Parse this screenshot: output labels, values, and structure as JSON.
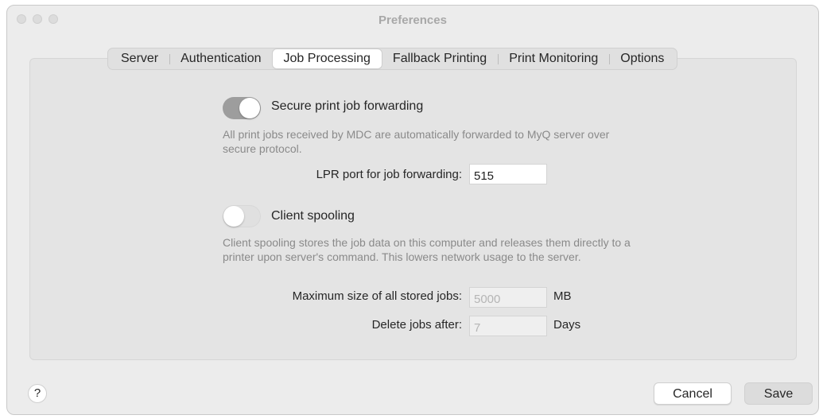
{
  "window": {
    "title": "Preferences"
  },
  "tabs": [
    {
      "label": "Server",
      "active": false
    },
    {
      "label": "Authentication",
      "active": false
    },
    {
      "label": "Job Processing",
      "active": true
    },
    {
      "label": "Fallback Printing",
      "active": false
    },
    {
      "label": "Print Monitoring",
      "active": false
    },
    {
      "label": "Options",
      "active": false
    }
  ],
  "secure_forwarding": {
    "label": "Secure print job forwarding",
    "enabled": true,
    "description": "All print jobs received by MDC are automatically forwarded to MyQ server over secure protocol.",
    "port_label": "LPR port for job forwarding:",
    "port_value": "515"
  },
  "client_spooling": {
    "label": "Client spooling",
    "enabled": false,
    "description": "Client spooling stores the job data on this computer and releases them directly to a printer upon server's command. This lowers network usage to the server.",
    "max_size_label": "Maximum size of all stored jobs:",
    "max_size_value": "5000",
    "max_size_unit": "MB",
    "delete_label": "Delete jobs after:",
    "delete_value": "7",
    "delete_unit": "Days"
  },
  "footer": {
    "help_label": "?",
    "cancel_label": "Cancel",
    "save_label": "Save"
  },
  "colors": {
    "toggle_on": "#9d9d9d",
    "window_bg": "#ececec",
    "panel_bg": "#e4e4e4"
  }
}
